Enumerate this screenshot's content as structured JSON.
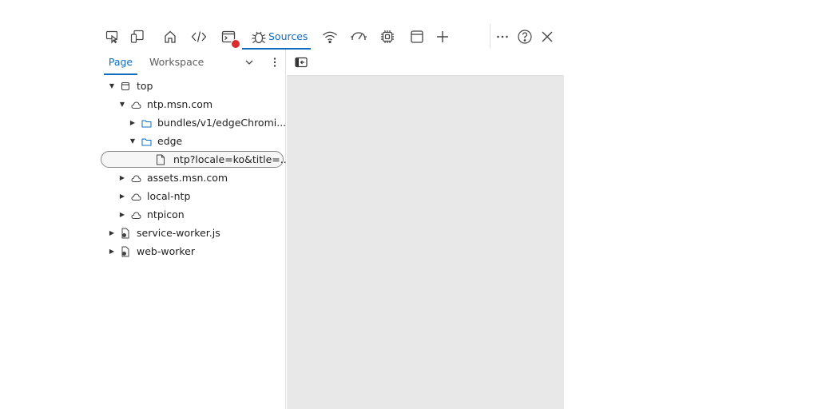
{
  "toolbar": {
    "tools": [
      {
        "icon": "inspect-element-icon"
      },
      {
        "icon": "device-emulation-icon"
      },
      {
        "icon": "home-icon"
      },
      {
        "icon": "elements-code-icon"
      },
      {
        "icon": "console-icon",
        "badge": "error"
      }
    ],
    "active_tab": {
      "icon": "bug-icon",
      "label": "Sources"
    },
    "more_tools": [
      {
        "icon": "network-wifi-icon"
      },
      {
        "icon": "performance-gauge-icon"
      },
      {
        "icon": "memory-chip-icon"
      },
      {
        "icon": "application-window-icon"
      },
      {
        "icon": "plus-icon"
      }
    ],
    "actions": [
      {
        "icon": "more-options-icon"
      },
      {
        "icon": "help-icon"
      },
      {
        "icon": "close-icon"
      }
    ],
    "accent_color": "#0f6cbd",
    "badge_color": "#d92c2c"
  },
  "sidebar": {
    "tabs": [
      {
        "label": "Page",
        "active": true
      },
      {
        "label": "Workspace",
        "active": false
      }
    ],
    "tree": [
      {
        "label": "top",
        "icon": "frame-icon",
        "expanded": true,
        "depth": 0
      },
      {
        "label": "ntp.msn.com",
        "icon": "cloud-icon",
        "expanded": true,
        "depth": 1
      },
      {
        "label": "bundles/v1/edgeChromi...",
        "icon": "folder-icon",
        "expanded": false,
        "depth": 2
      },
      {
        "label": "edge",
        "icon": "folder-icon",
        "expanded": true,
        "depth": 2
      },
      {
        "label": "ntp?locale=ko&title=...",
        "icon": "file-icon",
        "selected": true,
        "depth": 3
      },
      {
        "label": "assets.msn.com",
        "icon": "cloud-icon",
        "expanded": false,
        "depth": 1
      },
      {
        "label": "local-ntp",
        "icon": "cloud-icon",
        "expanded": false,
        "depth": 1
      },
      {
        "label": "ntpicon",
        "icon": "cloud-icon",
        "expanded": false,
        "depth": 1
      },
      {
        "label": "service-worker.js",
        "icon": "worker-file-icon",
        "expanded": false,
        "depth": 0
      },
      {
        "label": "web-worker",
        "icon": "worker-file-icon",
        "expanded": false,
        "depth": 0
      }
    ]
  },
  "editor": {
    "toggle_icon": "show-navigator-icon"
  }
}
